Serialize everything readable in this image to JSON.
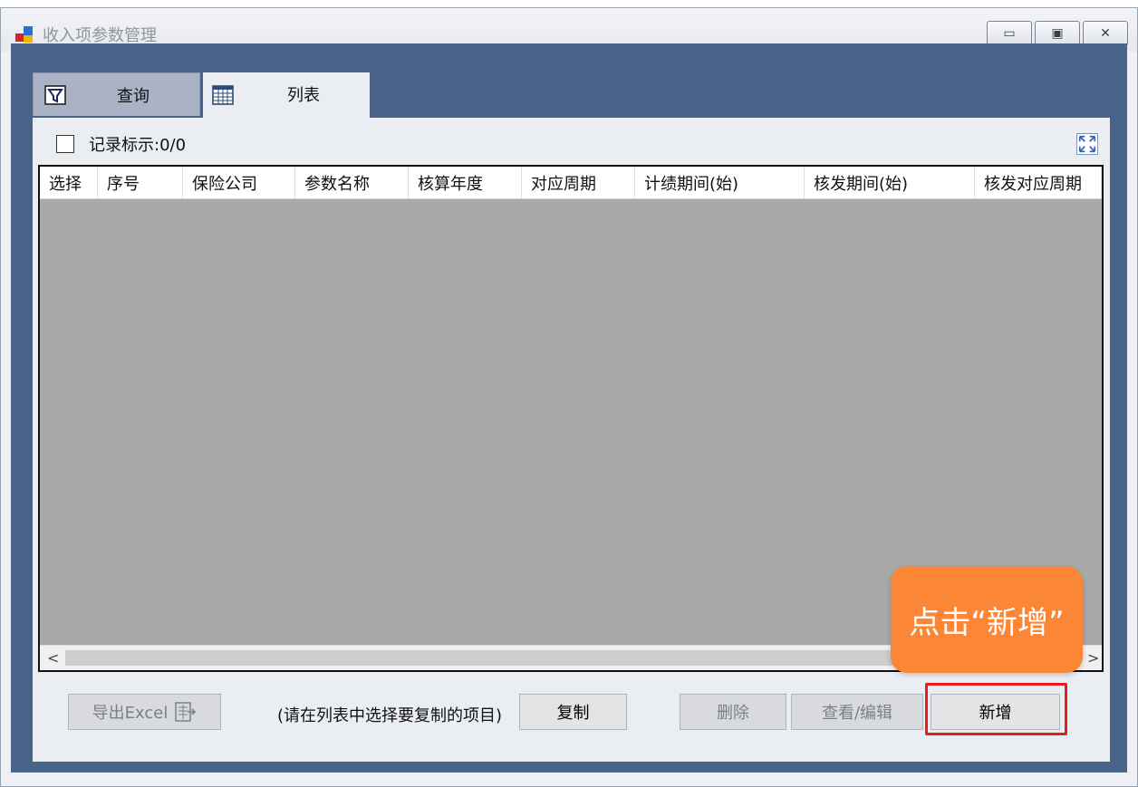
{
  "window": {
    "title": "收入项参数管理",
    "controls": {
      "minimize": "▭",
      "restore": "▣",
      "close": "✕"
    }
  },
  "tabs": [
    {
      "label": "查询",
      "icon": "filter-icon",
      "active": false
    },
    {
      "label": "列表",
      "icon": "table-icon",
      "active": true
    }
  ],
  "toolbar": {
    "record_label": "记录标示:0/0",
    "expand_icon": "fullscreen-expand-icon"
  },
  "grid": {
    "columns": [
      "选择",
      "序号",
      "保险公司",
      "参数名称",
      "核算年度",
      "对应周期",
      "计绩期间(始)",
      "核发期间(始)",
      "核发对应周期"
    ],
    "rows": [],
    "scroll_left": "<",
    "scroll_right": ">"
  },
  "actions": {
    "export_label": "导出Excel",
    "copy_hint": "(请在列表中选择要复制的项目)",
    "copy_label": "复制",
    "delete_label": "删除",
    "view_edit_label": "查看/编辑",
    "add_label": "新增"
  },
  "annotation": {
    "callout_text": "点击“新增”",
    "callout_color": "#fb8636",
    "highlight_color": "#e81c1c"
  },
  "colors": {
    "frame": "#4a638a",
    "panel": "#eaedf2",
    "grid_empty": "#a9a9a9"
  }
}
